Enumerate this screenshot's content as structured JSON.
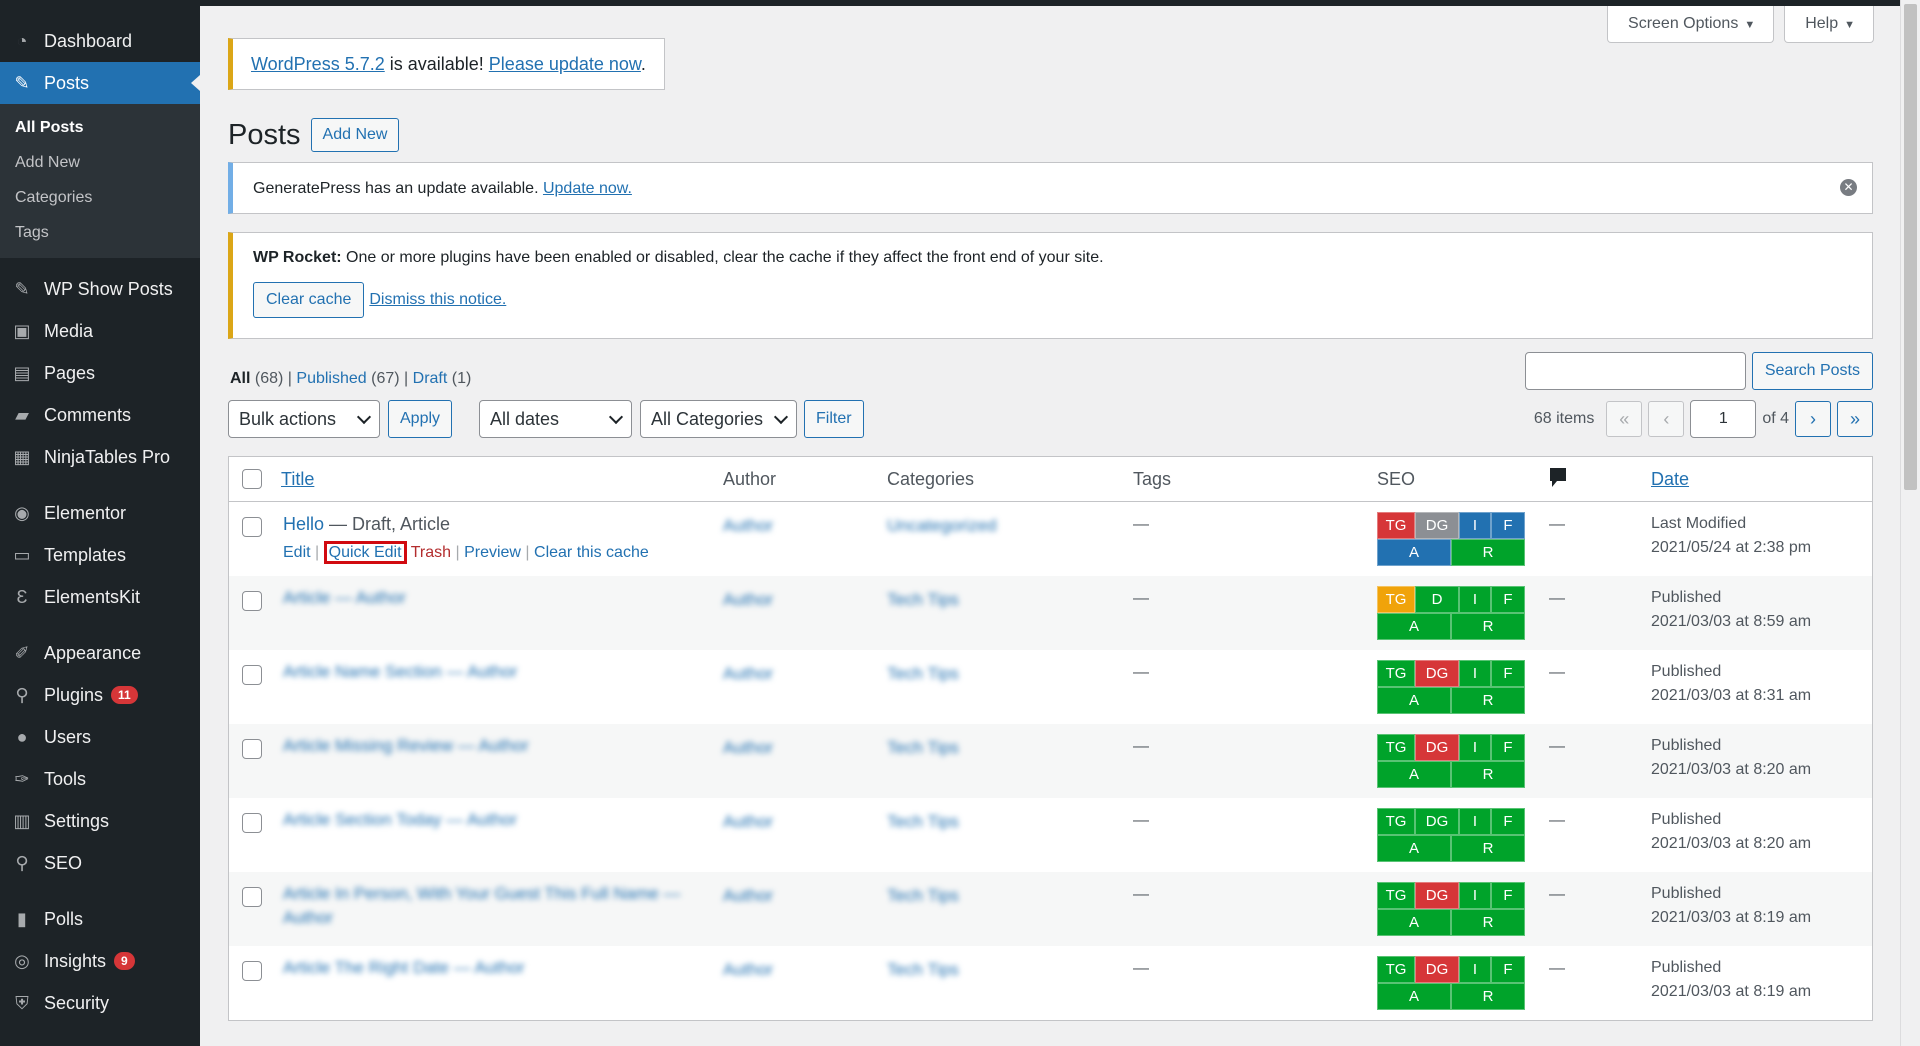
{
  "sidebar": {
    "items": [
      {
        "label": "Dashboard",
        "icon": "dashboard-icon",
        "glyph": "◔"
      },
      {
        "label": "Posts",
        "icon": "pin-icon",
        "glyph": "✎",
        "active": true
      },
      {
        "label": "WP Show Posts",
        "icon": "pin-icon",
        "glyph": "✎"
      },
      {
        "label": "Media",
        "icon": "media-icon",
        "glyph": "▣"
      },
      {
        "label": "Pages",
        "icon": "pages-icon",
        "glyph": "▤"
      },
      {
        "label": "Comments",
        "icon": "comment-icon",
        "glyph": "▰"
      },
      {
        "label": "NinjaTables Pro",
        "icon": "table-icon",
        "glyph": "▦"
      },
      {
        "label": "Elementor",
        "icon": "elementor-icon",
        "glyph": "◉"
      },
      {
        "label": "Templates",
        "icon": "folder-icon",
        "glyph": "▭"
      },
      {
        "label": "ElementsKit",
        "icon": "elementskit-icon",
        "glyph": "Ɛ"
      },
      {
        "label": "Appearance",
        "icon": "brush-icon",
        "glyph": "✐"
      },
      {
        "label": "Plugins",
        "icon": "plugin-icon",
        "glyph": "⚲",
        "badge": "11"
      },
      {
        "label": "Users",
        "icon": "user-icon",
        "glyph": "●"
      },
      {
        "label": "Tools",
        "icon": "wrench-icon",
        "glyph": "✑"
      },
      {
        "label": "Settings",
        "icon": "settings-icon",
        "glyph": "▥"
      },
      {
        "label": "SEO",
        "icon": "search-icon",
        "glyph": "⚲"
      },
      {
        "label": "Polls",
        "icon": "chart-bar-icon",
        "glyph": "▮"
      },
      {
        "label": "Insights",
        "icon": "insights-icon",
        "glyph": "◎",
        "badge": "9"
      },
      {
        "label": "Security",
        "icon": "shield-icon",
        "glyph": "⛨"
      }
    ],
    "posts_submenu": [
      "All Posts",
      "Add New",
      "Categories",
      "Tags"
    ]
  },
  "screen_meta": {
    "screen_options": "Screen Options",
    "help": "Help"
  },
  "update_nag": {
    "version_link": "WordPress 5.7.2",
    "middle": " is available! ",
    "update_link": "Please update now",
    "end": "."
  },
  "page": {
    "title": "Posts",
    "add_new": "Add New"
  },
  "notice_info": {
    "text": "GeneratePress has an update available. ",
    "link": "Update now."
  },
  "notice_warn": {
    "bold": "WP Rocket:",
    "text": " One or more plugins have been enabled or disabled, clear the cache if they affect the front end of your site.",
    "clear_cache": "Clear cache",
    "dismiss": "Dismiss this notice."
  },
  "views": {
    "all": "All",
    "all_count": " (68)",
    "published": "Published",
    "published_count": " (67)",
    "draft": "Draft",
    "draft_count": " (1)",
    "sep": " | "
  },
  "search": {
    "button": "Search Posts",
    "value": ""
  },
  "tablenav": {
    "bulk_actions": "Bulk actions",
    "apply": "Apply",
    "dates": "All dates",
    "categories": "All Categories",
    "filter": "Filter",
    "items": "68 items",
    "first": "«",
    "prev": "‹",
    "current_page": "1",
    "of_pages": "of 4",
    "next": "›",
    "last": "»"
  },
  "columns": {
    "title": "Title",
    "author": "Author",
    "categories": "Categories",
    "tags": "Tags",
    "seo": "SEO",
    "comments_icon": "comment-icon",
    "date": "Date"
  },
  "first_row": {
    "title": "Hello",
    "state": " — Draft, Article",
    "actions": {
      "edit": "Edit",
      "quick_edit": "Quick Edit",
      "trash": "Trash",
      "preview": "Preview",
      "clear_cache": "Clear this cache"
    }
  },
  "rows": [
    {
      "title": "Hello",
      "author": "Author",
      "category": "Uncategorized",
      "tags": "—",
      "comments": "—",
      "date_status": "Last Modified",
      "date": "2021/05/24 at 2:38 pm",
      "seo": {
        "tg": "#d63638",
        "dg": "#8c8f94",
        "i": "#2271b1",
        "f": "#2271b1",
        "a": "#2271b1",
        "r": "#00a32a",
        "d_label": "DG"
      }
    },
    {
      "title": "Article — Author",
      "author": "Author",
      "category": "Tech Tips",
      "tags": "—",
      "comments": "—",
      "date_status": "Published",
      "date": "2021/03/03 at 8:59 am",
      "seo": {
        "tg": "#f0a30a",
        "dg": "#00a32a",
        "i": "#00a32a",
        "f": "#00a32a",
        "a": "#00a32a",
        "r": "#00a32a",
        "d_label": "D"
      }
    },
    {
      "title": "Article Name Section — Author",
      "author": "Author",
      "category": "Tech Tips",
      "tags": "—",
      "comments": "—",
      "date_status": "Published",
      "date": "2021/03/03 at 8:31 am",
      "seo": {
        "tg": "#00a32a",
        "dg": "#d63638",
        "i": "#00a32a",
        "f": "#00a32a",
        "a": "#00a32a",
        "r": "#00a32a",
        "d_label": "DG"
      }
    },
    {
      "title": "Article Missing Review — Author",
      "author": "Author",
      "category": "Tech Tips",
      "tags": "—",
      "comments": "—",
      "date_status": "Published",
      "date": "2021/03/03 at 8:20 am",
      "seo": {
        "tg": "#00a32a",
        "dg": "#d63638",
        "i": "#00a32a",
        "f": "#00a32a",
        "a": "#00a32a",
        "r": "#00a32a",
        "d_label": "DG"
      }
    },
    {
      "title": "Article Section Today — Author",
      "author": "Author",
      "category": "Tech Tips",
      "tags": "—",
      "comments": "—",
      "date_status": "Published",
      "date": "2021/03/03 at 8:20 am",
      "seo": {
        "tg": "#00a32a",
        "dg": "#00a32a",
        "i": "#00a32a",
        "f": "#00a32a",
        "a": "#00a32a",
        "r": "#00a32a",
        "d_label": "DG"
      }
    },
    {
      "title": "Article In Person, With Your Guest This Full Name —",
      "title2": "Author",
      "author": "Author",
      "category": "Tech Tips",
      "tags": "—",
      "comments": "—",
      "date_status": "Published",
      "date": "2021/03/03 at 8:19 am",
      "seo": {
        "tg": "#00a32a",
        "dg": "#d63638",
        "i": "#00a32a",
        "f": "#00a32a",
        "a": "#00a32a",
        "r": "#00a32a",
        "d_label": "DG"
      }
    },
    {
      "title": "Article The Right Date — Author",
      "author": "Author",
      "category": "Tech Tips",
      "tags": "—",
      "comments": "—",
      "date_status": "Published",
      "date": "2021/03/03 at 8:19 am",
      "seo": {
        "tg": "#00a32a",
        "dg": "#d63638",
        "i": "#00a32a",
        "f": "#00a32a",
        "a": "#00a32a",
        "r": "#00a32a",
        "d_label": "DG"
      }
    }
  ],
  "seo_labels": {
    "tg": "TG",
    "i": "I",
    "f": "F",
    "a": "A",
    "r": "R"
  }
}
